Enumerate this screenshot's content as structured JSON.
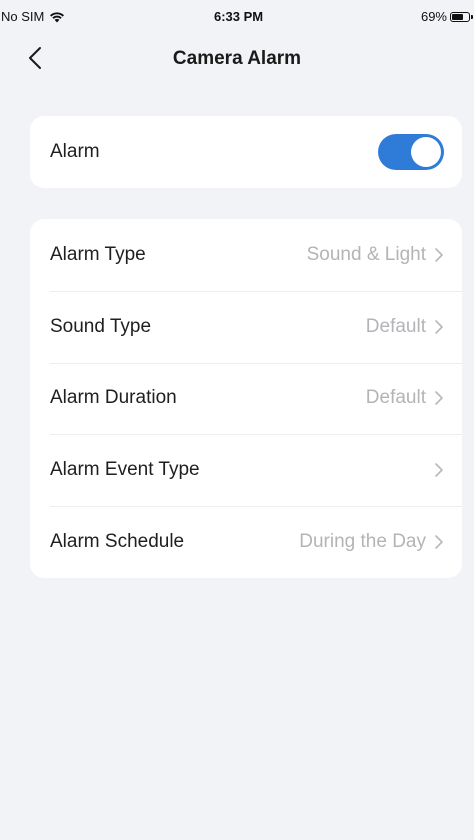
{
  "status_bar": {
    "carrier": "No SIM",
    "wifi_icon": "wifi-icon",
    "time": "6:33 PM",
    "battery": "69%",
    "battery_level": 0.69
  },
  "nav": {
    "back_icon": "chevron-left-icon",
    "title": "Camera Alarm"
  },
  "alarm_card": {
    "label": "Alarm",
    "enabled": true,
    "toggle_color": "#2f7bd8"
  },
  "settings": {
    "items": [
      {
        "label": "Alarm Type",
        "value": "Sound & Light"
      },
      {
        "label": "Sound Type",
        "value": "Default"
      },
      {
        "label": "Alarm Duration",
        "value": "Default"
      },
      {
        "label": "Alarm Event Type",
        "value": ""
      },
      {
        "label": "Alarm Schedule",
        "value": "During the Day"
      }
    ]
  }
}
